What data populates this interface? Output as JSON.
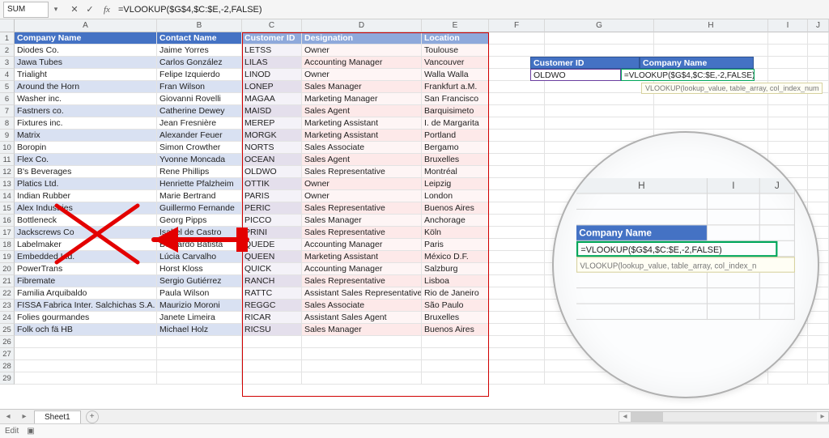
{
  "name_box": "SUM",
  "formula_text": "=VLOOKUP($G$4,$C:$E,-2,FALSE)",
  "fx_label": "fx",
  "columns": [
    "A",
    "B",
    "C",
    "D",
    "E",
    "F",
    "G",
    "H",
    "I",
    "J"
  ],
  "row_count": 29,
  "headers": {
    "A": "Company Name",
    "B": "Contact Name",
    "C": "Customer ID",
    "D": "Designation",
    "E": "Location"
  },
  "rows": [
    {
      "A": "Diodes Co.",
      "B": "Jaime Yorres",
      "C": "LETSS",
      "D": "Owner",
      "E": "Toulouse"
    },
    {
      "A": "Jawa Tubes",
      "B": "Carlos González",
      "C": "LILAS",
      "D": "Accounting Manager",
      "E": "Vancouver"
    },
    {
      "A": "Trialight",
      "B": "Felipe Izquierdo",
      "C": "LINOD",
      "D": "Owner",
      "E": "Walla Walla"
    },
    {
      "A": "Around the Horn",
      "B": "Fran Wilson",
      "C": "LONEP",
      "D": "Sales Manager",
      "E": "Frankfurt a.M."
    },
    {
      "A": "Washer inc.",
      "B": "Giovanni Rovelli",
      "C": "MAGAA",
      "D": "Marketing Manager",
      "E": "San Francisco"
    },
    {
      "A": "Fastners co.",
      "B": "Catherine Dewey",
      "C": "MAISD",
      "D": "Sales Agent",
      "E": "Barquisimeto"
    },
    {
      "A": "Fixtures inc.",
      "B": "Jean Fresnière",
      "C": "MEREP",
      "D": "Marketing Assistant",
      "E": "I. de Margarita"
    },
    {
      "A": "Matrix",
      "B": "Alexander Feuer",
      "C": "MORGK",
      "D": "Marketing Assistant",
      "E": "Portland"
    },
    {
      "A": "Boropin",
      "B": "Simon Crowther",
      "C": "NORTS",
      "D": "Sales Associate",
      "E": "Bergamo"
    },
    {
      "A": "Flex Co.",
      "B": "Yvonne Moncada",
      "C": "OCEAN",
      "D": "Sales Agent",
      "E": "Bruxelles"
    },
    {
      "A": "B's Beverages",
      "B": "Rene Phillips",
      "C": "OLDWO",
      "D": "Sales Representative",
      "E": "Montréal"
    },
    {
      "A": "Platics Ltd.",
      "B": "Henriette Pfalzheim",
      "C": "OTTIK",
      "D": "Owner",
      "E": "Leipzig"
    },
    {
      "A": "Indian Rubber",
      "B": "Marie Bertrand",
      "C": "PARIS",
      "D": "Owner",
      "E": "London"
    },
    {
      "A": "Alex Industries",
      "B": "Guillermo Fernande",
      "C": "PERIC",
      "D": "Sales Representative",
      "E": "Buenos Aires"
    },
    {
      "A": "Bottleneck",
      "B": "Georg Pipps",
      "C": "PICCO",
      "D": "Sales Manager",
      "E": "Anchorage"
    },
    {
      "A": "Jackscrews Co",
      "B": "Isabel de Castro",
      "C": "PRINI",
      "D": "Sales Representative",
      "E": "Köln"
    },
    {
      "A": "Labelmaker",
      "B": "Bernardo Batista",
      "C": "QUEDE",
      "D": "Accounting Manager",
      "E": "Paris"
    },
    {
      "A": "Embedded Ltd.",
      "B": "Lúcia Carvalho",
      "C": "QUEEN",
      "D": "Marketing Assistant",
      "E": "México D.F."
    },
    {
      "A": "PowerTrans",
      "B": "Horst Kloss",
      "C": "QUICK",
      "D": "Accounting Manager",
      "E": "Salzburg"
    },
    {
      "A": "Fibremate",
      "B": "Sergio Gutiérrez",
      "C": "RANCH",
      "D": "Sales Representative",
      "E": "Lisboa"
    },
    {
      "A": "Familia Arquibaldo",
      "B": "Paula Wilson",
      "C": "RATTC",
      "D": "Assistant Sales Representative",
      "E": "Rio de Janeiro"
    },
    {
      "A": "FISSA Fabrica Inter. Salchichas S.A.",
      "B": "Maurizio Moroni",
      "C": "REGGC",
      "D": "Sales Associate",
      "E": "São Paulo"
    },
    {
      "A": "Folies gourmandes",
      "B": "Janete Limeira",
      "C": "RICAR",
      "D": "Assistant Sales Agent",
      "E": "Bruxelles"
    },
    {
      "A": "Folk och fä HB",
      "B": "Michael Holz",
      "C": "RICSU",
      "D": "Sales Manager",
      "E": "Buenos Aires"
    }
  ],
  "lookup": {
    "g3": "Customer ID",
    "h3": "Company Name",
    "g4": "OLDWO",
    "h4": "=VLOOKUP($G$4,$C:$E,-2,FALSE)"
  },
  "tooltip_main": "VLOOKUP(lookup_value, table_array, col_index_num",
  "tooltip_mag": "VLOOKUP(lookup_value, table_array, col_index_n",
  "sheet_tab": "Sheet1",
  "status_text": "Edit"
}
